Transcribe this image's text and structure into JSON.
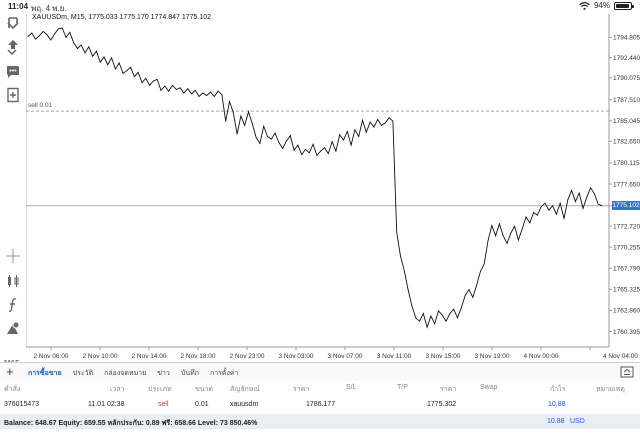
{
  "status_bar": {
    "time": "11:04",
    "date": "พฤ. 4 พ.ย.",
    "battery": "94%",
    "battery_level": 0.94
  },
  "toolbar": {
    "timeframe": "M15",
    "icons": [
      "quotes-icon",
      "trade-icon",
      "chat-icon",
      "new-order-icon",
      "crosshair-icon",
      "indicators-icon",
      "function-icon",
      "objects-icon"
    ]
  },
  "chart_header": {
    "symbol_info": "XAUUSDm, M15, 1775.033 1775.170 1774.847 1775.102"
  },
  "order_line": {
    "label": "sell 0.01",
    "price": 1786.177
  },
  "current_price": "1775.102",
  "chart_data": {
    "type": "line",
    "title": "XAUUSDm, M15, 1775.033 1775.170 1774.847 1775.102",
    "ylim": [
      1759.4,
      1796.6
    ],
    "y_ticks": [
      "1794.805",
      "1792.440",
      "1790.075",
      "1787.510",
      "1785.045",
      "1782.650",
      "1780.115",
      "1777.650",
      "1775.102",
      "1772.720",
      "1770.255",
      "1767.790",
      "1765.325",
      "1762.860",
      "1760.395"
    ],
    "x_ticks": [
      "2 Nov 06:00",
      "2 Nov 10:00",
      "2 Nov 14:00",
      "2 Nov 18:00",
      "2 Nov 23:00",
      "3 Nov 03:00",
      "3 Nov 07:00",
      "3 Nov 11:00",
      "3 Nov 15:00",
      "3 Nov 19:00",
      "4 Nov 00:00",
      "4 Nov 04:00"
    ],
    "series": [
      {
        "values": [
          1794.9,
          1795.3,
          1794.6,
          1795.0,
          1795.5,
          1795.1,
          1794.5,
          1795.2,
          1795.8,
          1795.9,
          1794.8,
          1795.4,
          1794.2,
          1793.5,
          1793.9,
          1793.0,
          1793.7,
          1792.6,
          1793.2,
          1791.9,
          1792.5,
          1791.6,
          1792.4,
          1791.1,
          1791.8,
          1790.6,
          1790.9,
          1791.3,
          1790.2,
          1790.7,
          1789.5,
          1790.0,
          1789.2,
          1789.7,
          1789.9,
          1788.6,
          1789.1,
          1788.5,
          1789.2,
          1788.7,
          1788.9,
          1788.3,
          1788.8,
          1788.2,
          1788.6,
          1787.9,
          1788.3,
          1788.0,
          1788.4,
          1787.9,
          1788.5,
          1788.1,
          1785.0,
          1787.3,
          1786.0,
          1783.5,
          1785.6,
          1784.5,
          1786.1,
          1784.7,
          1783.1,
          1782.4,
          1784.4,
          1783.2,
          1782.9,
          1783.6,
          1782.5,
          1781.8,
          1782.7,
          1783.3,
          1781.6,
          1782.2,
          1781.1,
          1781.7,
          1781.3,
          1782.3,
          1781.0,
          1781.5,
          1781.9,
          1781.2,
          1782.6,
          1781.5,
          1783.4,
          1782.8,
          1783.8,
          1782.2,
          1784.0,
          1783.2,
          1785.1,
          1783.7,
          1784.9,
          1784.3,
          1785.2,
          1784.5,
          1784.8,
          1785.4,
          1785.0,
          1772.0,
          1769.2,
          1767.5,
          1765.3,
          1763.4,
          1762.0,
          1761.6,
          1762.5,
          1760.9,
          1762.2,
          1761.3,
          1762.8,
          1762.3,
          1761.6,
          1762.5,
          1763.0,
          1762.0,
          1763.2,
          1764.6,
          1765.3,
          1764.4,
          1765.8,
          1767.4,
          1768.3,
          1771.0,
          1772.8,
          1771.6,
          1773.0,
          1771.6,
          1770.7,
          1771.9,
          1772.7,
          1771.1,
          1772.4,
          1773.8,
          1773.1,
          1774.3,
          1774.0,
          1775.0,
          1775.4,
          1774.6,
          1775.1,
          1774.1,
          1775.4,
          1773.6,
          1775.8,
          1776.9,
          1775.6,
          1776.6,
          1774.8,
          1776.1,
          1777.2,
          1776.5,
          1775.3,
          1775.1
        ]
      }
    ]
  },
  "tabs": [
    "การซื้อขาย",
    "ประวัติ",
    "กล่องจดหมาย",
    "ข่าว",
    "บันทึก",
    "การตั้งค่า"
  ],
  "table": {
    "headers": [
      "คำสั่ง",
      "เวลา",
      "ประเภท",
      "ขนาด",
      "สัญลักษณ์",
      "ราคา",
      "S/L",
      "T/P",
      "ราคา",
      "Swap",
      "กำไร",
      "หมายเหตุ"
    ],
    "row": {
      "order": "376015473",
      "time": "11.01 02:38",
      "type": "sell",
      "size": "0.01",
      "symbol": "xauusdm",
      "price": "1786.177",
      "current_price": "1775.302",
      "profit": "10.88"
    }
  },
  "balance": {
    "text": "Balance: 648.67 Equity: 659.55 หลักประกัน: 0.89 ฟรี: 658.66 Level: 73 850.46%",
    "total": "10.88",
    "currency": "USD"
  }
}
